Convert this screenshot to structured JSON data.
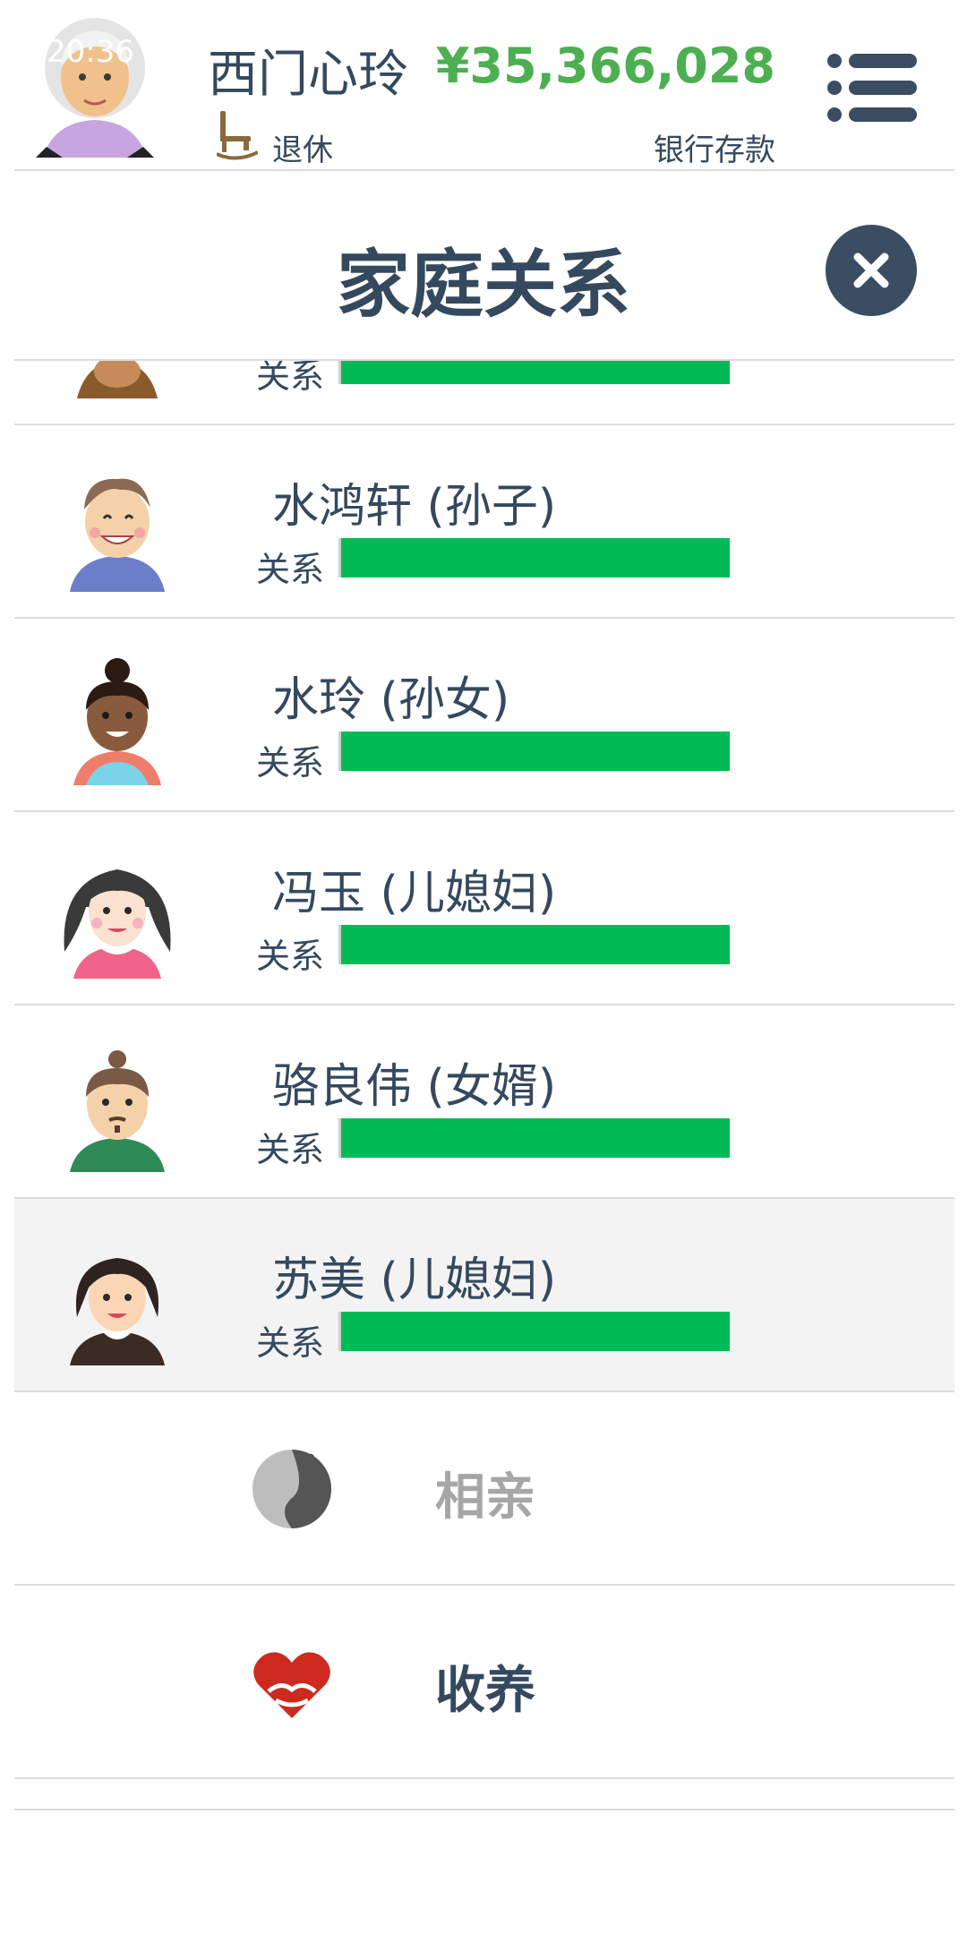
{
  "header": {
    "status_time": "20:36",
    "player_name": "西门心玲",
    "status": "退休",
    "money": "¥35,366,028",
    "money_label": "银行存款"
  },
  "dialog": {
    "title": "家庭关系"
  },
  "relationship_label": "关系",
  "family": [
    {
      "name": "",
      "relationship_level": 1.0,
      "avatar": "partial-avatar"
    },
    {
      "name": "水鸿轩 (孙子)",
      "relationship_level": 1.0,
      "avatar": "boy-avatar"
    },
    {
      "name": "水玲 (孙女)",
      "relationship_level": 1.0,
      "avatar": "girl-avatar"
    },
    {
      "name": "冯玉 (儿媳妇)",
      "relationship_level": 1.0,
      "avatar": "woman-avatar"
    },
    {
      "name": "骆良伟 (女婿)",
      "relationship_level": 1.0,
      "avatar": "man-avatar"
    },
    {
      "name": "苏美 (儿媳妇)",
      "relationship_level": 1.0,
      "avatar": "woman-avatar"
    }
  ],
  "actions": [
    {
      "label": "相亲",
      "enabled": false,
      "icon": "matchmaking-icon"
    },
    {
      "label": "收养",
      "enabled": true,
      "icon": "adoption-heart-icon"
    }
  ],
  "colors": {
    "money": "#4caf50",
    "bar": "#00bb55",
    "text": "#34495e",
    "close_button": "#3a4d63",
    "disabled": "#a6a6a6",
    "highlight_row": "#f3f3f3"
  }
}
